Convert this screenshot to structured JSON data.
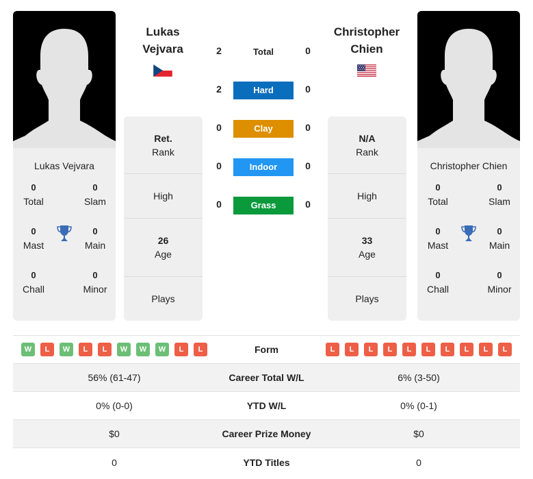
{
  "players": {
    "left": {
      "name_line1": "Lukas",
      "name_line2": "Vejvara",
      "full_name": "Lukas Vejvara",
      "flag": "czech-republic",
      "titles": {
        "total": "0",
        "total_label": "Total",
        "slam": "0",
        "slam_label": "Slam",
        "mast": "0",
        "mast_label": "Mast",
        "main": "0",
        "main_label": "Main",
        "chall": "0",
        "chall_label": "Chall",
        "minor": "0",
        "minor_label": "Minor"
      },
      "info": {
        "rank_value": "Ret.",
        "rank_label": "Rank",
        "high_label": "High",
        "age_value": "26",
        "age_label": "Age",
        "plays_label": "Plays"
      }
    },
    "right": {
      "name_line1": "Christopher",
      "name_line2": "Chien",
      "full_name": "Christopher Chien",
      "flag": "united-states",
      "titles": {
        "total": "0",
        "total_label": "Total",
        "slam": "0",
        "slam_label": "Slam",
        "mast": "0",
        "mast_label": "Mast",
        "main": "0",
        "main_label": "Main",
        "chall": "0",
        "chall_label": "Chall",
        "minor": "0",
        "minor_label": "Minor"
      },
      "info": {
        "rank_value": "N/A",
        "rank_label": "Rank",
        "high_label": "High",
        "age_value": "33",
        "age_label": "Age",
        "plays_label": "Plays"
      }
    }
  },
  "h2h": [
    {
      "label": "Total",
      "left": "2",
      "right": "0",
      "color": ""
    },
    {
      "label": "Hard",
      "left": "2",
      "right": "0",
      "color": "#0a6ebd"
    },
    {
      "label": "Clay",
      "left": "0",
      "right": "0",
      "color": "#dd8f00"
    },
    {
      "label": "Indoor",
      "left": "0",
      "right": "0",
      "color": "#2196f3"
    },
    {
      "label": "Grass",
      "left": "0",
      "right": "0",
      "color": "#0a9a3c"
    }
  ],
  "form_colors": {
    "W": "#6cbf76",
    "L": "#ee5f47"
  },
  "stats": {
    "form_label": "Form",
    "left_form": [
      "W",
      "L",
      "W",
      "L",
      "L",
      "W",
      "W",
      "W",
      "L",
      "L"
    ],
    "right_form": [
      "L",
      "L",
      "L",
      "L",
      "L",
      "L",
      "L",
      "L",
      "L",
      "L"
    ],
    "rows": [
      {
        "label": "Career Total W/L",
        "left": "56% (61-47)",
        "right": "6% (3-50)"
      },
      {
        "label": "YTD W/L",
        "left": "0% (0-0)",
        "right": "0% (0-1)"
      },
      {
        "label": "Career Prize Money",
        "left": "$0",
        "right": "$0"
      },
      {
        "label": "YTD Titles",
        "left": "0",
        "right": "0"
      }
    ]
  }
}
